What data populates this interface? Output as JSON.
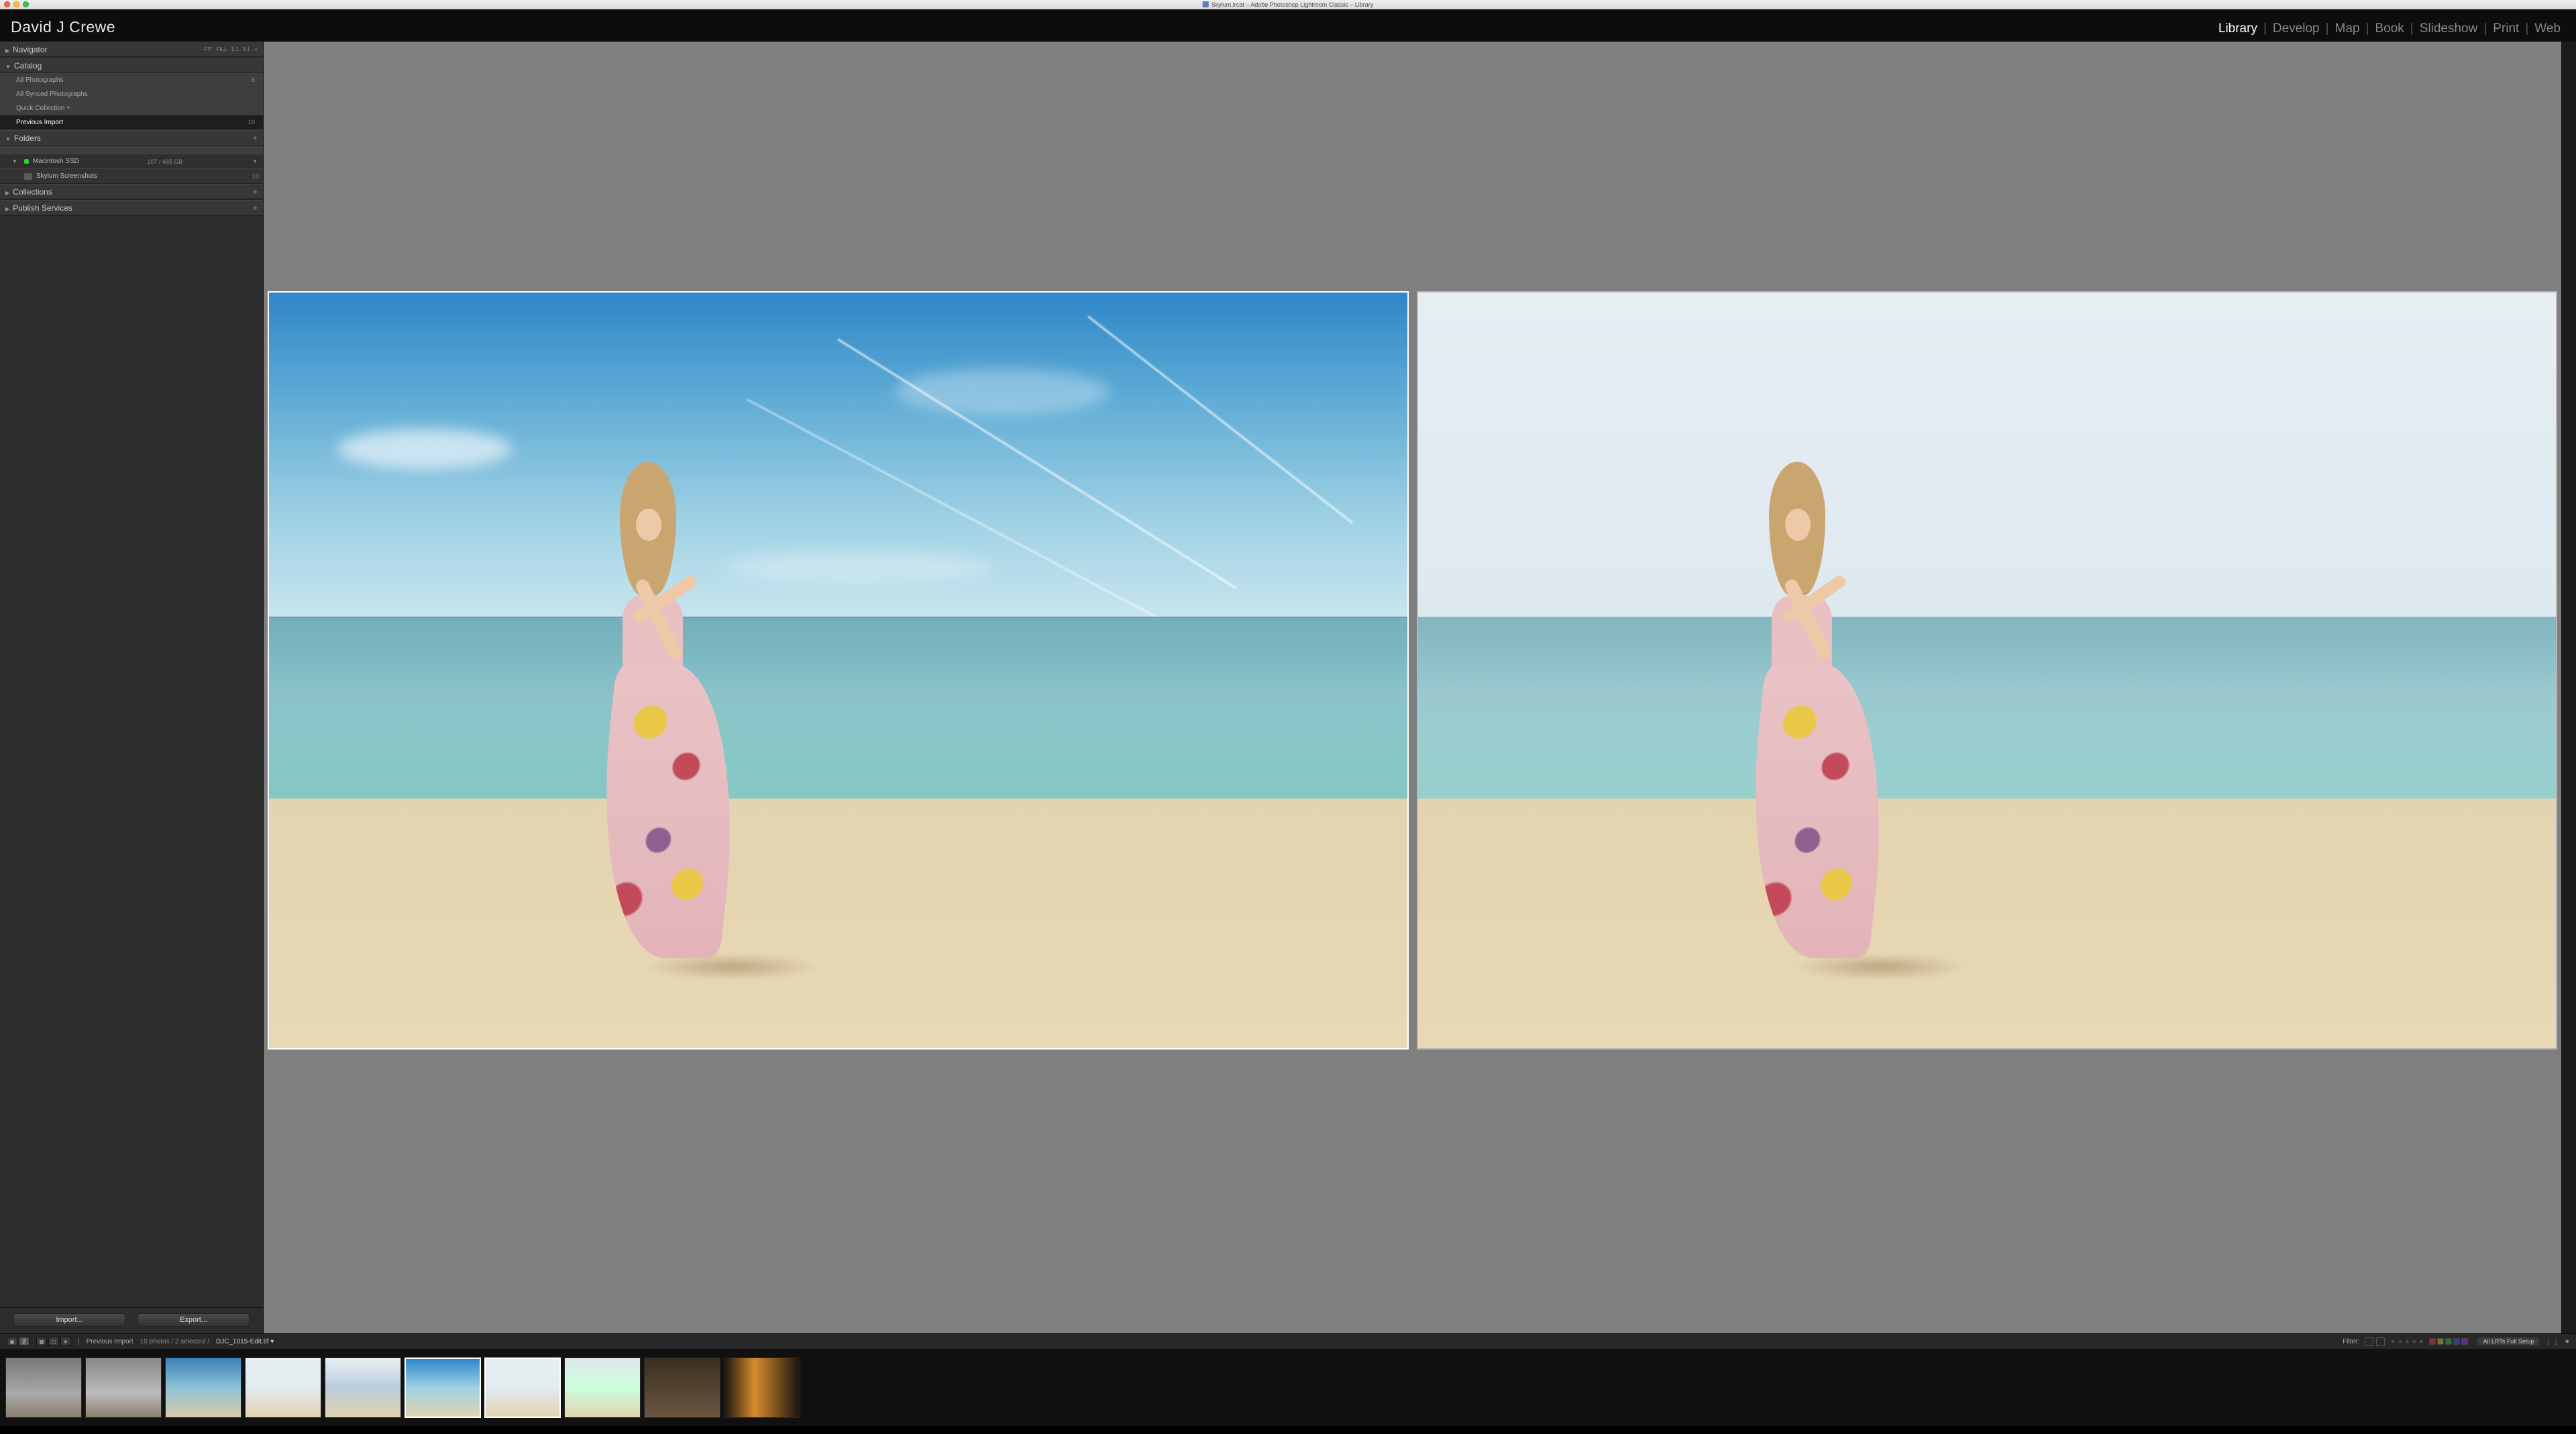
{
  "os_title": "Skylum.lrcat  –  Adobe Photoshop Lightroom Classic  –  Library",
  "identity": "David J Crewe",
  "modules": [
    {
      "label": "Library",
      "active": true
    },
    {
      "label": "Develop"
    },
    {
      "label": "Map"
    },
    {
      "label": "Book"
    },
    {
      "label": "Slideshow"
    },
    {
      "label": "Print"
    },
    {
      "label": "Web"
    }
  ],
  "navigator": {
    "title": "Navigator",
    "modes": [
      "FIT",
      "FILL",
      "1:1",
      "3:1"
    ]
  },
  "catalog": {
    "title": "Catalog",
    "items": [
      {
        "label": "All Photographs",
        "count": "6"
      },
      {
        "label": "All Synced Photographs",
        "count": ""
      },
      {
        "label": "Quick Collection  +",
        "count": ""
      },
      {
        "label": "Previous Import",
        "count": "10",
        "active": true
      }
    ]
  },
  "folders": {
    "title": "Folders",
    "plus": "+",
    "volume": {
      "name": "Macintosh SSD",
      "stat": "107 / 465 GB"
    },
    "items": [
      {
        "label": "Skylum Screenshots",
        "count": "10"
      }
    ]
  },
  "collections": {
    "title": "Collections",
    "plus": "+"
  },
  "publish": {
    "title": "Publish Services",
    "plus": "+"
  },
  "leftActions": {
    "import": "Import...",
    "export": "Export..."
  },
  "filterBar": {
    "breadcrumb_source": "Previous Import",
    "breadcrumb_stats": "10 photos / 2 selected / ",
    "breadcrumb_file": "DJC_1015-Edit.tif  ▾",
    "filter_label": "Filter:",
    "source_pill": "All LRTs Full Setup"
  },
  "thumbs": [
    {
      "idx": "1"
    },
    {
      "idx": "2"
    },
    {
      "idx": "3"
    },
    {
      "idx": "4"
    },
    {
      "idx": "5"
    },
    {
      "idx": "6",
      "sel": true
    },
    {
      "idx": "7",
      "sel": true
    },
    {
      "idx": "8"
    },
    {
      "idx": "9"
    },
    {
      "idx": "10"
    }
  ]
}
